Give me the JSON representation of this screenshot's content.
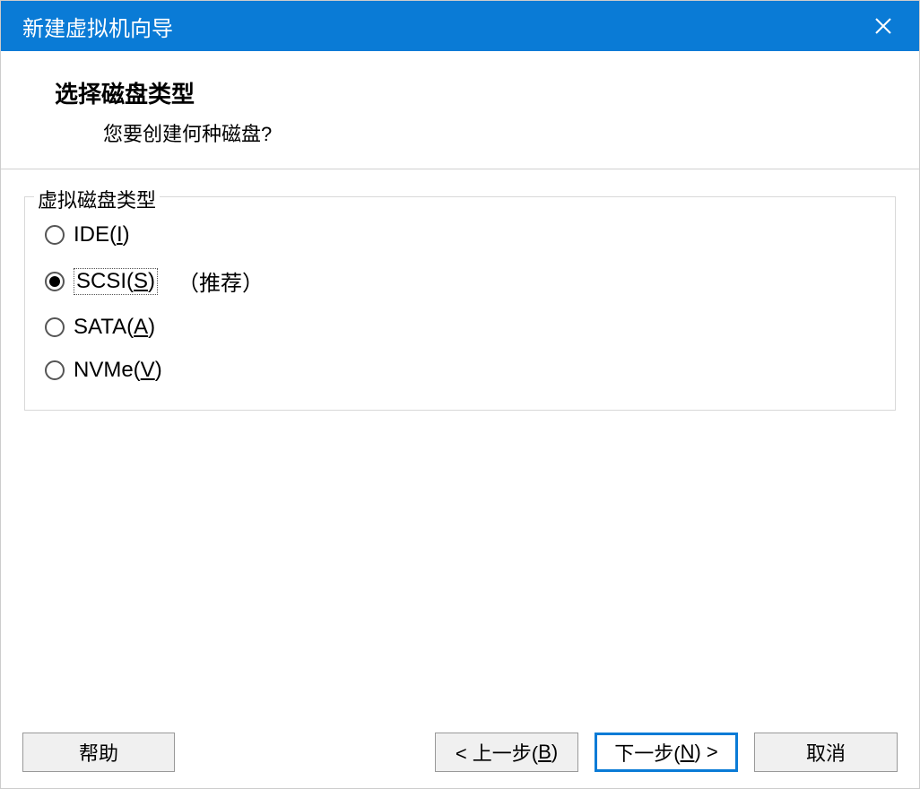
{
  "window": {
    "title": "新建虚拟机向导"
  },
  "header": {
    "title": "选择磁盘类型",
    "subtitle": "您要创建何种磁盘?"
  },
  "fieldset": {
    "legend": "虚拟磁盘类型"
  },
  "options": {
    "ide": {
      "label_pre": "IDE(",
      "key": "I",
      "label_post": ")"
    },
    "scsi": {
      "label_pre": "SCSI(",
      "key": "S",
      "label_post": ")",
      "extra": "（推荐）"
    },
    "sata": {
      "label_pre": "SATA(",
      "key": "A",
      "label_post": ")"
    },
    "nvme": {
      "label_pre": "NVMe(",
      "key": "V",
      "label_post": ")"
    }
  },
  "footer": {
    "help": "帮助",
    "back_pre": "< 上一步(",
    "back_key": "B",
    "back_post": ")",
    "next_pre": "下一步(",
    "next_key": "N",
    "next_post": ") >",
    "cancel": "取消"
  }
}
